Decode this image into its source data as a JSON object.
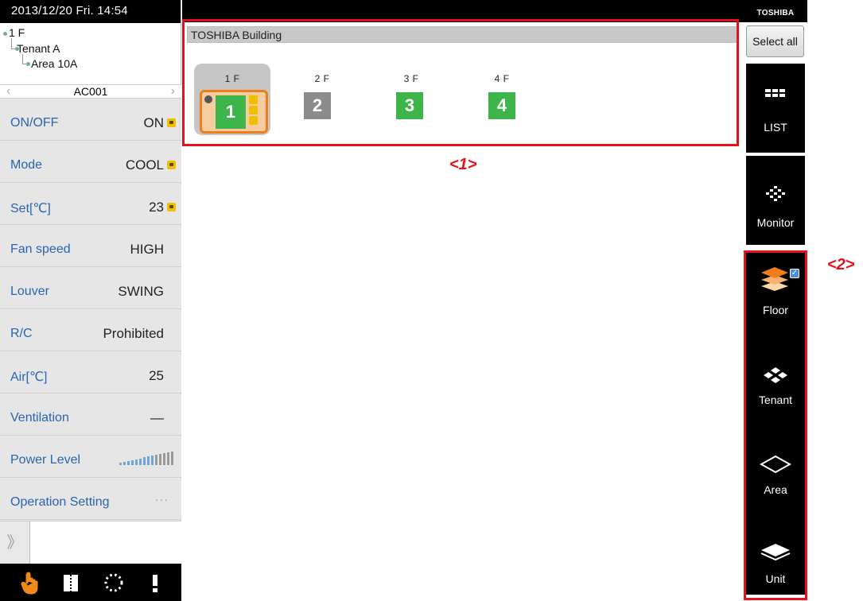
{
  "datetime": "2013/12/20 Fri.  14:54",
  "tree": {
    "floor": "1 F",
    "tenant": "Tenant A",
    "area": "Area 10A"
  },
  "unit_nav": {
    "unit": "AC001",
    "prev": "‹",
    "next": "›"
  },
  "status_rows": {
    "onoff": {
      "label": "ON/OFF",
      "value": "ON"
    },
    "mode": {
      "label": "Mode",
      "value": "COOL"
    },
    "set": {
      "label": "Set[℃]",
      "value": "23"
    },
    "fan": {
      "label": "Fan speed",
      "value": "HIGH"
    },
    "louver": {
      "label": "Louver",
      "value": "SWING"
    },
    "rc": {
      "label": "R/C",
      "value": "Prohibited"
    },
    "air": {
      "label": "Air[℃]",
      "value": "25"
    },
    "vent": {
      "label": "Ventilation",
      "value": "—"
    },
    "power": {
      "label": "Power Level"
    },
    "ops": {
      "label": "Operation Setting",
      "value": "···"
    }
  },
  "expand_glyph": "》",
  "building": "TOSHIBA Building",
  "floors": [
    {
      "name": "1 F",
      "number": "1",
      "selected": true,
      "color": "green"
    },
    {
      "name": "2 F",
      "number": "2",
      "selected": false,
      "color": "gray"
    },
    {
      "name": "3 F",
      "number": "3",
      "selected": false,
      "color": "green"
    },
    {
      "name": "4 F",
      "number": "4",
      "selected": false,
      "color": "green"
    }
  ],
  "annotations": {
    "a1": "<1>",
    "a2": "<2>"
  },
  "brand": "TOSHIBA",
  "nav": {
    "select_all": "Select all",
    "list": "LIST",
    "monitor": "Monitor",
    "floor": "Floor",
    "tenant": "Tenant",
    "area": "Area",
    "unit": "Unit"
  },
  "colors": {
    "accent_blue": "#2a64b0",
    "tile_green": "#3db54a",
    "tile_gray": "#8c8c8c",
    "select_orange": "#ef7d1a",
    "annotation_red": "#e3131b",
    "lock_yellow": "#f0c000"
  },
  "icons": {
    "bottom": [
      "hand-touch-icon",
      "schedule-book-icon",
      "dotted-circle-icon",
      "alert-exclamation-icon"
    ]
  }
}
